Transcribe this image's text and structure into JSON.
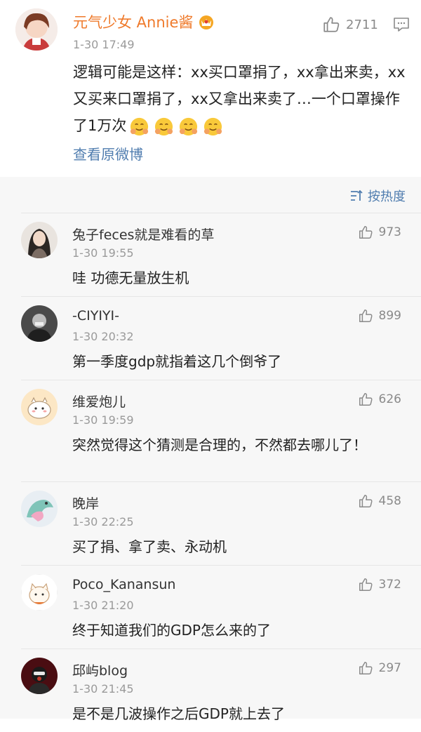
{
  "post": {
    "username": "元气少女 Annie酱",
    "time": "1-30 17:49",
    "likes": "2711",
    "content": "逻辑可能是这样：xx买口罩捐了，xx拿出来卖，xx又买来口罩捐了，xx又拿出来卖了…一个口罩操作了1万次",
    "view_original": "查看原微博"
  },
  "sort": {
    "label": "按热度"
  },
  "comments": [
    {
      "name": "兔子feces就是难看的草",
      "time": "1-30 19:55",
      "likes": "973",
      "text": "哇 功德无量放生机"
    },
    {
      "name": "-CIYIYI-",
      "time": "1-30 20:32",
      "likes": "899",
      "text": "第一季度gdp就指着这几个倒爷了"
    },
    {
      "name": "维爱炮儿",
      "time": "1-30 19:59",
      "likes": "626",
      "text": "突然觉得这个猜测是合理的，不然都去哪儿了！"
    },
    {
      "name": "晚岸",
      "time": "1-30 22:25",
      "likes": "458",
      "text": "买了捐、拿了卖、永动机"
    },
    {
      "name": "Poco_Kanansun",
      "time": "1-30 21:20",
      "likes": "372",
      "text": "终于知道我们的GDP怎么来的了"
    },
    {
      "name": "邱屿blog",
      "time": "1-30 21:45",
      "likes": "297",
      "text": "是不是几波操作之后GDP就上去了"
    }
  ],
  "colors": {
    "username": "#ef7a2b",
    "link": "#507daf",
    "meta": "#9a9a9a"
  }
}
